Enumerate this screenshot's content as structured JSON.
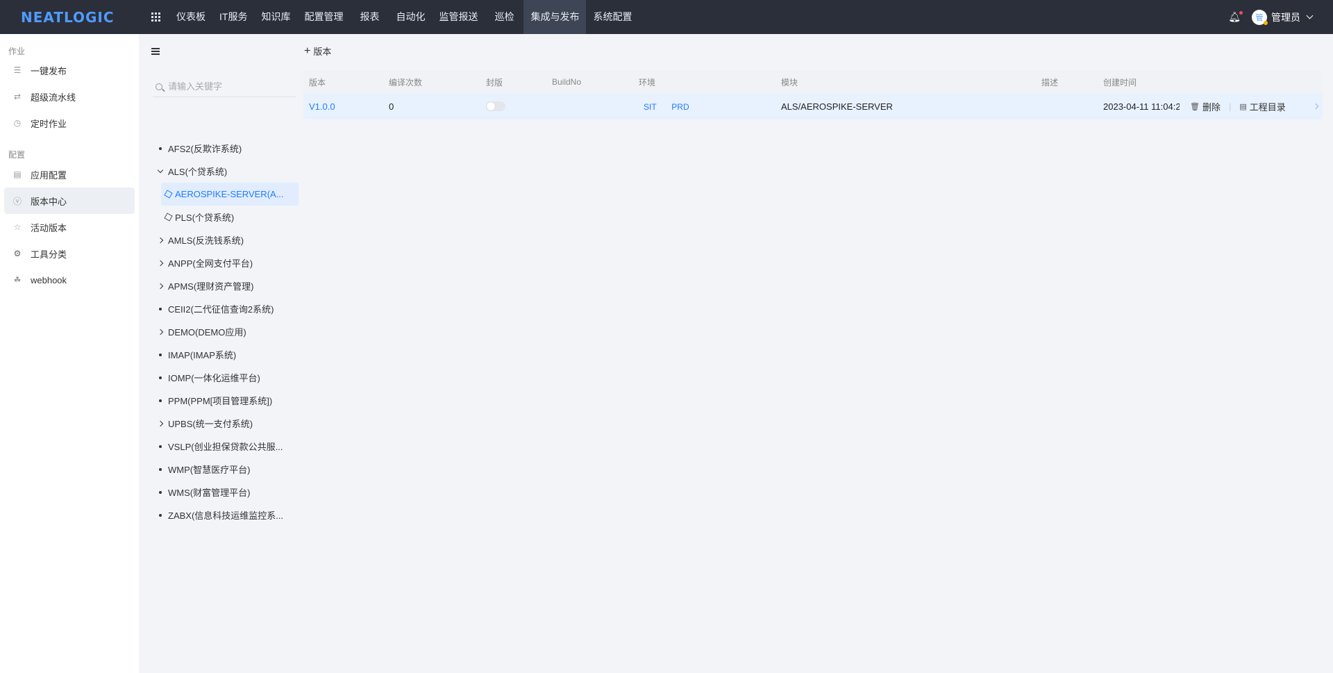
{
  "topbar": {
    "logo": "NEATLOGIC",
    "nav": [
      "仪表板",
      "IT服务",
      "知识库",
      "配置管理",
      "报表",
      "自动化",
      "监管报送",
      "巡检",
      "集成与发布",
      "系统配置"
    ],
    "active_nav": "集成与发布",
    "user": {
      "avatar_text": "管",
      "name": "管理员"
    }
  },
  "leftnav": {
    "groups": [
      {
        "title": "作业",
        "items": [
          "一键发布",
          "超级流水线",
          "定时作业"
        ]
      },
      {
        "title": "配置",
        "items": [
          "应用配置",
          "版本中心",
          "活动版本",
          "工具分类",
          "webhook"
        ]
      }
    ],
    "active_item": "版本中心"
  },
  "tree": {
    "search_placeholder": "请输入关键字",
    "nodes": [
      "AFS2(反欺诈系统)",
      "ALS(个贷系统)",
      "AEROSPIKE-SERVER(A...",
      "PLS(个贷系统)",
      "AMLS(反洗钱系统)",
      "ANPP(全网支付平台)",
      "APMS(理财资产管理)",
      "CEII2(二代征信查询2系统)",
      "DEMO(DEMO应用)",
      "IMAP(IMAP系统)",
      "IOMP(一体化运维平台)",
      "PPM(PPM[项目管理系统])",
      "UPBS(统一支付系统)",
      "VSLP(创业担保贷款公共服...",
      "WMP(智慧医疗平台)",
      "WMS(财富管理平台)",
      "ZABX(信息科技运维监控系..."
    ]
  },
  "main": {
    "add_label": "版本",
    "columns": [
      "版本",
      "编译次数",
      "封版",
      "BuildNo",
      "环境",
      "模块",
      "描述",
      "创建时间"
    ],
    "rows": [
      {
        "version": "V1.0.0",
        "compile_count": "0",
        "sealed": false,
        "build_no": "",
        "env": [
          "SIT",
          "PRD"
        ],
        "module": "ALS/AEROSPIKE-SERVER",
        "description": "",
        "created": "2023-04-11 11:04:2",
        "actions": [
          "删除",
          "工程目录"
        ]
      }
    ]
  }
}
